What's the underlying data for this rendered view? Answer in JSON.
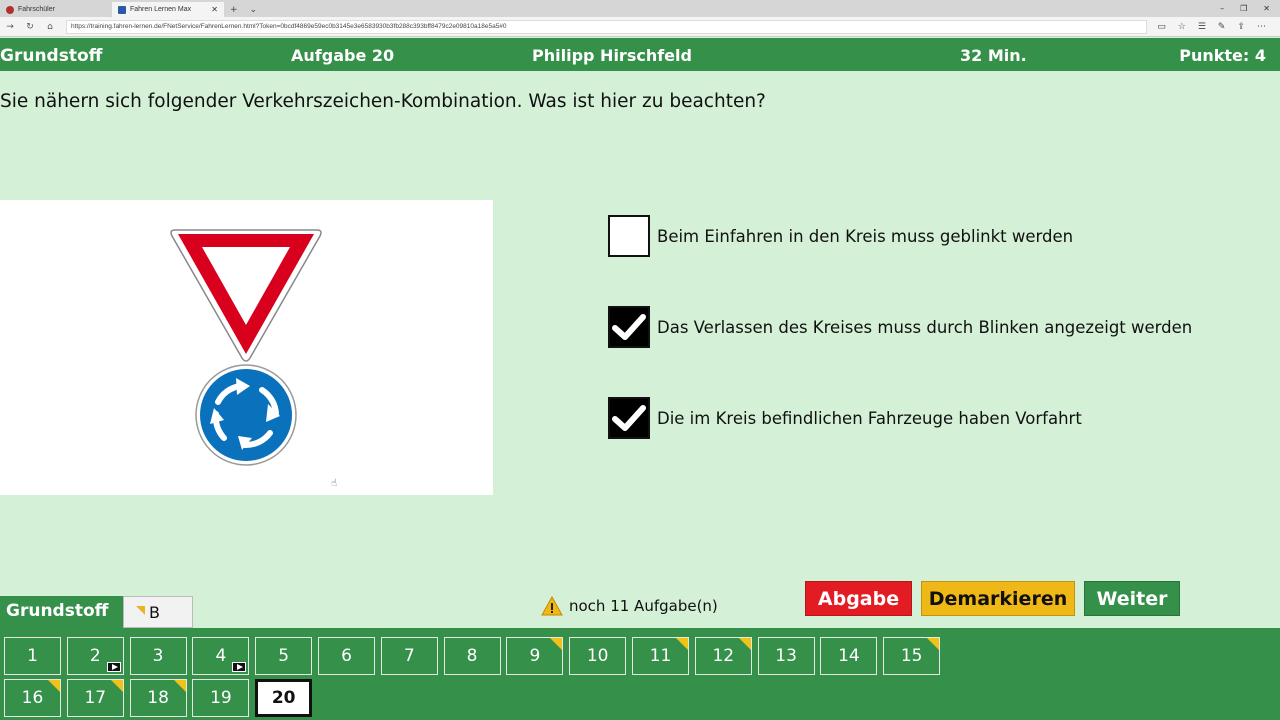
{
  "browser": {
    "tabs": [
      {
        "label": "Fahrschüler",
        "active": false
      },
      {
        "label": "Fahren Lernen Max",
        "active": true
      }
    ],
    "url": "https://training.fahren-lernen.de/FNetService/FahrenLernen.html?Token=0bcdf4869e59ec0b3145e3e6583930b3fb288c393bff8479c2e09810a18e5a5#0"
  },
  "header": {
    "section": "Grundstoff",
    "task": "Aufgabe 20",
    "user": "Philipp Hirschfeld",
    "time": "32 Min.",
    "points": "Punkte: 4"
  },
  "question": "Sie nähern sich folgender Verkehrszeichen-Kombination. Was ist hier zu beachten?",
  "image": {
    "signs": [
      "yield-sign",
      "roundabout-sign"
    ],
    "colors": {
      "red": "#d8001d",
      "blue": "#0a72bd"
    }
  },
  "answers": [
    {
      "text": "Beim Einfahren in den Kreis muss geblinkt werden",
      "checked": false
    },
    {
      "text": "Das Verlassen des Kreises muss durch Blinken angezeigt werden",
      "checked": true
    },
    {
      "text": "Die im Kreis befindlichen Fahrzeuge haben Vorfahrt",
      "checked": true
    }
  ],
  "bottom": {
    "tab_grundstoff": "Grundstoff",
    "tab_b": "B",
    "remaining": "noch 11 Aufgabe(n)",
    "buttons": {
      "submit": "Abgabe",
      "unmark": "Demarkieren",
      "next": "Weiter"
    }
  },
  "questions_nav": [
    {
      "n": "1"
    },
    {
      "n": "2",
      "video": true
    },
    {
      "n": "3"
    },
    {
      "n": "4",
      "video": true
    },
    {
      "n": "5"
    },
    {
      "n": "6"
    },
    {
      "n": "7"
    },
    {
      "n": "8"
    },
    {
      "n": "9",
      "marked": true
    },
    {
      "n": "10"
    },
    {
      "n": "11",
      "marked": true
    },
    {
      "n": "12",
      "marked": true
    },
    {
      "n": "13"
    },
    {
      "n": "14"
    },
    {
      "n": "15",
      "marked": true
    },
    {
      "n": "16",
      "marked": true
    },
    {
      "n": "17",
      "marked": true
    },
    {
      "n": "18",
      "marked": true
    },
    {
      "n": "19"
    },
    {
      "n": "20",
      "current": true
    }
  ],
  "colors": {
    "green": "#35904a",
    "background": "#d4f0d6",
    "submit": "#e31b23",
    "unmark": "#f0b816"
  }
}
